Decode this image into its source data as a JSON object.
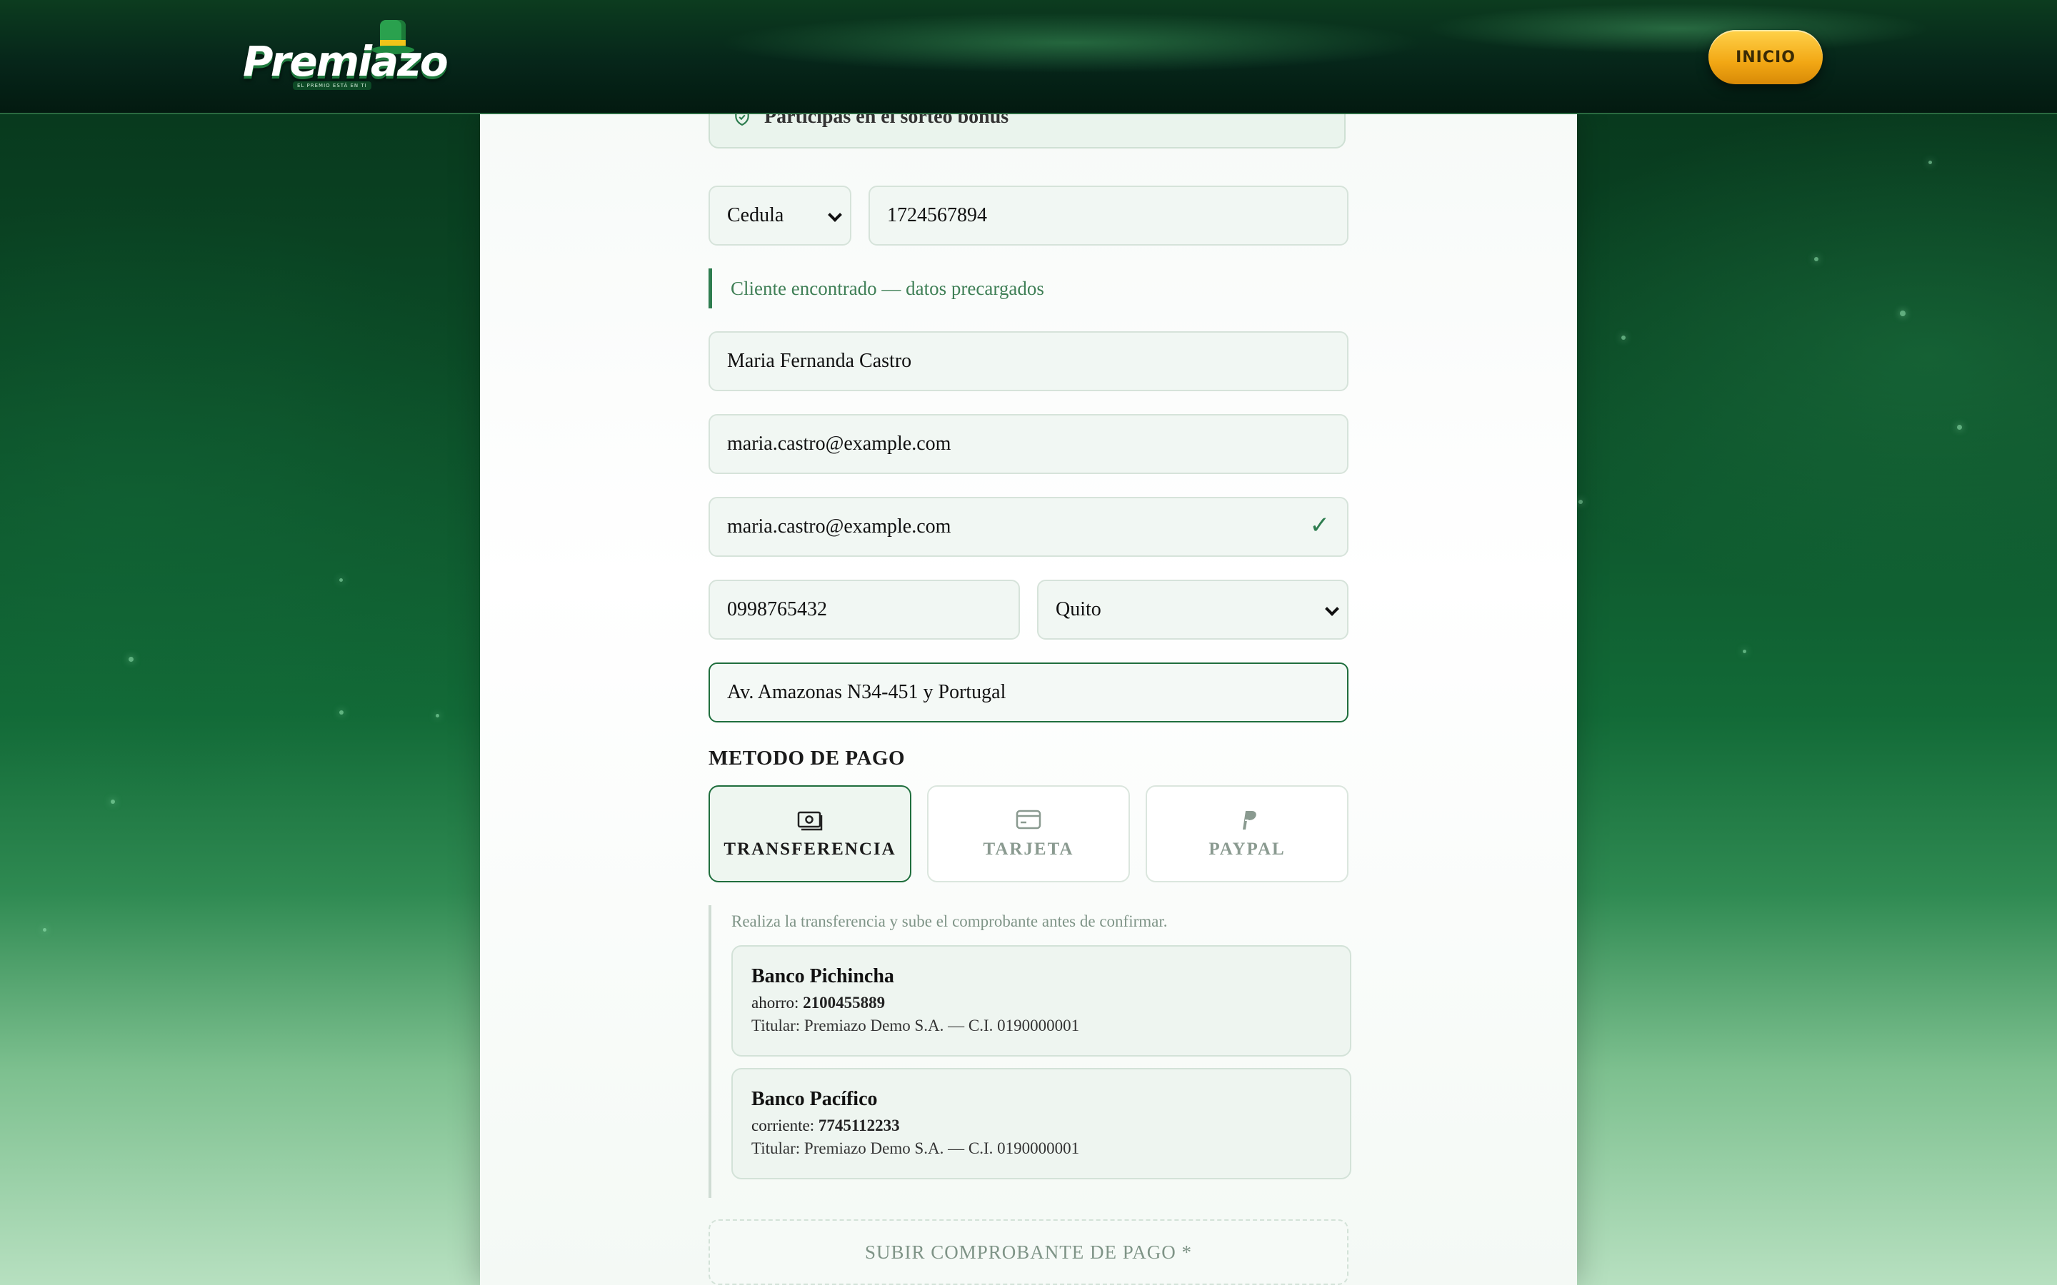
{
  "header": {
    "logo_text": "Premiazo",
    "logo_tagline": "EL PREMIO ESTÁ EN TI",
    "inicio_label": "INICIO"
  },
  "form": {
    "bonus_text": "Participas en el sorteo bonus",
    "doc_type": "Cedula",
    "doc_number": "1724567894",
    "found_text": "Cliente encontrado — datos precargados",
    "full_name": "Maria Fernanda Castro",
    "email": "maria.castro@example.com",
    "email_confirm": "maria.castro@example.com",
    "phone": "0998765432",
    "city": "Quito",
    "address": "Av. Amazonas N34-451 y Portugal"
  },
  "payment": {
    "title": "METODO DE PAGO",
    "methods": [
      {
        "label": "TRANSFERENCIA",
        "icon": "cash-icon",
        "selected": true
      },
      {
        "label": "TARJETA",
        "icon": "credit-card-icon",
        "selected": false
      },
      {
        "label": "PAYPAL",
        "icon": "paypal-icon",
        "selected": false
      }
    ],
    "note": "Realiza la transferencia y sube el comprobante antes de confirmar.",
    "banks": [
      {
        "name": "Banco Pichincha",
        "type": "ahorro:",
        "number": "2100455889",
        "owner": "Titular: Premiazo Demo S.A. — C.I. 0190000001"
      },
      {
        "name": "Banco Pacífico",
        "type": "corriente:",
        "number": "7745112233",
        "owner": "Titular: Premiazo Demo S.A. — C.I. 0190000001"
      }
    ],
    "upload_label": "SUBIR COMPROBANTE DE PAGO *"
  },
  "colors": {
    "brand_green": "#1f6e3d",
    "accent_gold": "#f2a714"
  }
}
